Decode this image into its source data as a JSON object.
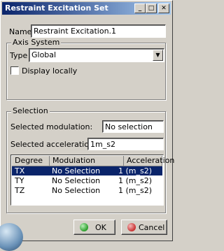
{
  "window": {
    "title": "Restraint Excitation Set",
    "min_icon": "minimize-icon",
    "max_icon": "maximize-icon",
    "close_icon": "close-icon"
  },
  "name": {
    "label": "Name",
    "value": "Restraint Excitation.1"
  },
  "axis_system": {
    "group_label": "Axis System",
    "type_label": "Type",
    "type_value": "Global",
    "display_locally_label": "Display locally",
    "display_locally_checked": false
  },
  "selection": {
    "group_label": "Selection",
    "modulation_label": "Selected modulation:",
    "modulation_value": "No selection",
    "acceleration_label": "Selected acceleration:",
    "acceleration_value": "1m_s2",
    "columns": [
      "Degree",
      "Modulation",
      "Acceleration"
    ],
    "rows": [
      {
        "degree": "TX",
        "modulation": "No Selection",
        "acceleration": "1 (m_s2)",
        "selected": true
      },
      {
        "degree": "TY",
        "modulation": "No Selection",
        "acceleration": "1 (m_s2)",
        "selected": false
      },
      {
        "degree": "TZ",
        "modulation": "No Selection",
        "acceleration": "1 (m_s2)",
        "selected": false
      }
    ]
  },
  "buttons": {
    "ok_label": "OK",
    "cancel_label": "Cancel",
    "ok_color": "#2a9d2a",
    "cancel_color": "#c83030"
  }
}
